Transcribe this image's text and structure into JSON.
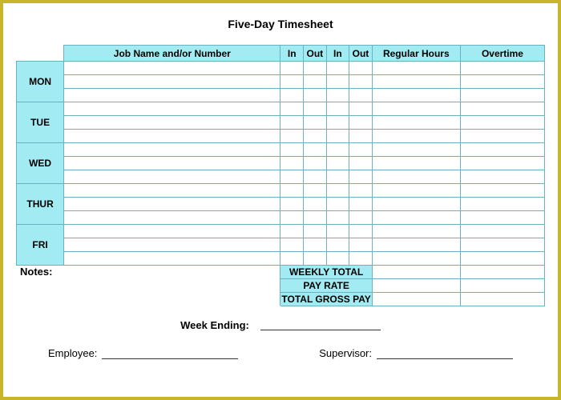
{
  "title": "Five-Day Timesheet",
  "headers": {
    "job": "Job Name and/or Number",
    "in1": "In",
    "out1": "Out",
    "in2": "In",
    "out2": "Out",
    "regular": "Regular Hours",
    "overtime": "Overtime"
  },
  "days": [
    "MON",
    "TUE",
    "WED",
    "THUR",
    "FRI"
  ],
  "notes_label": "Notes:",
  "summary": {
    "weekly_total": "WEEKLY TOTAL",
    "pay_rate": "PAY RATE",
    "total_gross": "TOTAL GROSS PAY"
  },
  "footer": {
    "week_ending": "Week Ending:",
    "employee": "Employee:",
    "supervisor": "Supervisor:"
  }
}
